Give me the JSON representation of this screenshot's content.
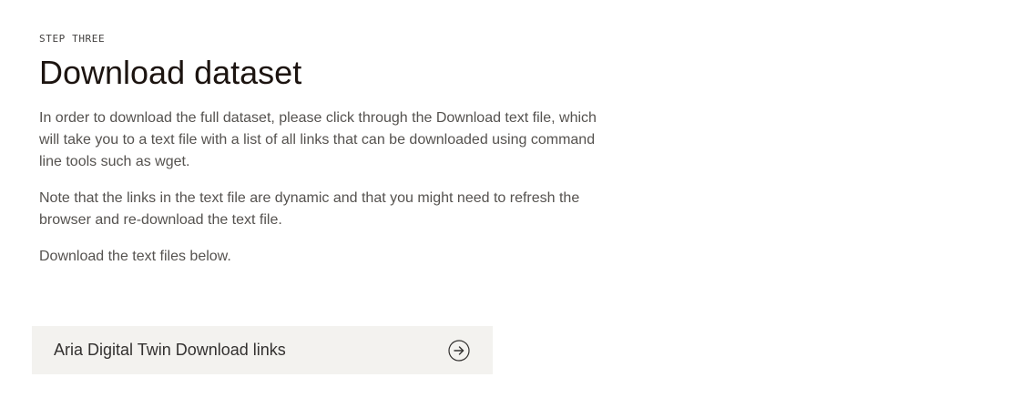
{
  "header": {
    "eyebrow": "STEP THREE",
    "title": "Download dataset"
  },
  "content": {
    "paragraphs": [
      "In order to download the full dataset, please click through the Download text file, which will take you to a text file with a list of all links that can be downloaded using command line tools such as wget.",
      "Note that the links in the text file are dynamic and that you might need to refresh the browser and re-download the text file.",
      "Download the text files below."
    ]
  },
  "download_card": {
    "label": "Aria Digital Twin Download links",
    "icon": "arrow-right-circle-icon"
  },
  "colors": {
    "title": "#1c1410",
    "body_text": "#55524f",
    "card_background": "#f3f2ef"
  }
}
